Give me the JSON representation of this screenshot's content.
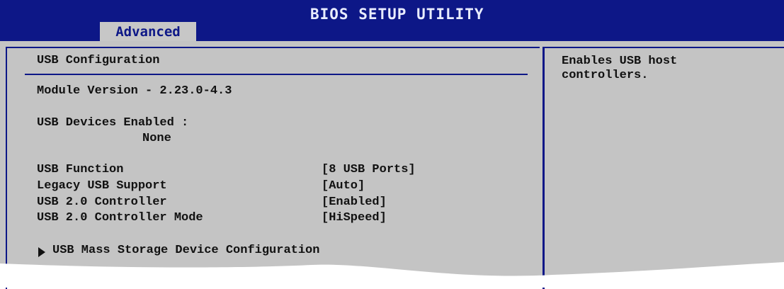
{
  "header": {
    "title": "BIOS SETUP UTILITY",
    "active_tab": "Advanced"
  },
  "main": {
    "section_title": "USB Configuration",
    "module_version": "Module Version - 2.23.0-4.3",
    "usb_devices_label": "USB Devices Enabled :",
    "usb_devices_value": "None",
    "settings": [
      {
        "label": "USB Function",
        "value": "[8 USB Ports]"
      },
      {
        "label": "Legacy USB Support",
        "value": "[Auto]"
      },
      {
        "label": "USB 2.0 Controller",
        "value": "[Enabled]"
      },
      {
        "label": "USB 2.0 Controller Mode",
        "value": "[HiSpeed]"
      }
    ],
    "submenu": "USB Mass Storage Device Configuration"
  },
  "help": {
    "lines": [
      "Enables USB host",
      "controllers."
    ]
  },
  "colors": {
    "header_bg": "#0d1787",
    "panel_bg": "#c4c4c4",
    "text": "#111111"
  }
}
